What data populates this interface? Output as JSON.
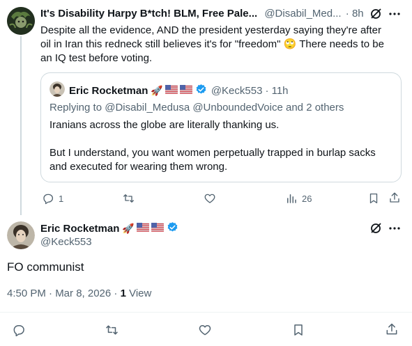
{
  "tweet": {
    "author_name": "It's Disability Harpy B*tch! BLM, Free Pale...",
    "handle": "@Disabil_Med...",
    "time": "· 8h",
    "text_line1": "Despite all the evidence, AND the president yesterday saying they're after",
    "text_line2": "oil in Iran this redneck still believes it's for \"freedom\" 🙄 There needs to be",
    "text_line3": "an IQ test before voting.",
    "reply_count": "1",
    "views_count": "26"
  },
  "quoted": {
    "author_name": "Eric Rocketman",
    "handle": "@Keck553",
    "time": "· 11h",
    "replying_prefix": "Replying to",
    "replying_to": "@Disabil_Medusa @UnboundedVoice and 2 others",
    "text_para1": "Iranians across the globe are literally thanking us.",
    "text_para2_line1": "But I understand, you want women perpetually trapped in burlap sacks",
    "text_para2_line2": "and executed for wearing them wrong."
  },
  "reply": {
    "author_name": "Eric Rocketman",
    "handle": "@Keck553",
    "text": "FO communist",
    "timestamp": "4:50 PM · Mar 8, 2026 ·",
    "view_count": "1",
    "view_label": "View"
  },
  "colors": {
    "accent": "#1d9bf0",
    "muted": "#536471",
    "border": "#cfd9de"
  },
  "icons": [
    "grok-icon",
    "more-icon",
    "reply-icon",
    "retweet-icon",
    "like-icon",
    "views-icon",
    "bookmark-icon",
    "share-icon",
    "verified-icon",
    "rocket-icon",
    "us-flag-icon"
  ]
}
